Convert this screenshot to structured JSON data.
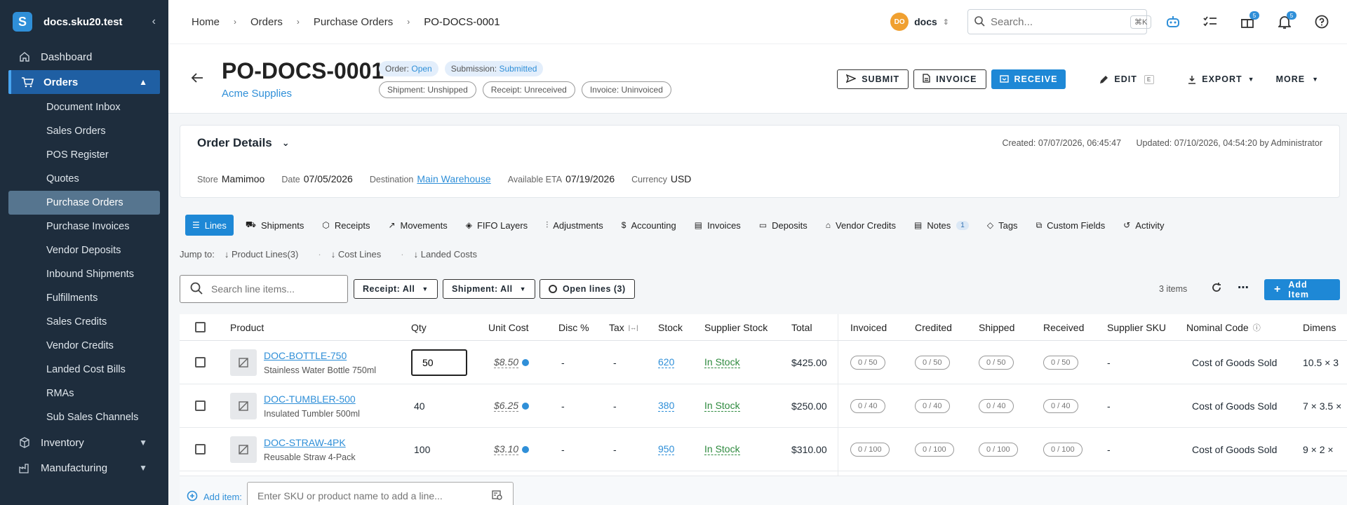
{
  "sidebar": {
    "logo": "S",
    "workspace": "docs.sku20.test",
    "items": [
      {
        "label": "Dashboard"
      },
      {
        "label": "Orders"
      },
      {
        "label": "Inventory"
      },
      {
        "label": "Manufacturing"
      }
    ],
    "orders_sub": [
      "Document Inbox",
      "Sales Orders",
      "POS Register",
      "Quotes",
      "Purchase Orders",
      "Purchase Invoices",
      "Vendor Deposits",
      "Inbound Shipments",
      "Fulfillments",
      "Sales Credits",
      "Vendor Credits",
      "Landed Cost Bills",
      "RMAs",
      "Sub Sales Channels"
    ]
  },
  "topbar": {
    "breadcrumbs": [
      "Home",
      "Orders",
      "Purchase Orders",
      "PO-DOCS-0001"
    ],
    "workspace_initials": "DO",
    "workspace_name": "docs",
    "search_placeholder": "Search...",
    "search_shortcut": "⌘K",
    "gift_badge": "5",
    "notif_badge": "5"
  },
  "header": {
    "title": "PO-DOCS-0001",
    "vendor": "Acme Supplies",
    "status_order_label": "Order:",
    "status_order_value": "Open",
    "status_submission_label": "Submission:",
    "status_submission_value": "Submitted",
    "shipment_status": "Shipment: Unshipped",
    "receipt_status": "Receipt: Unreceived",
    "invoice_status": "Invoice: Uninvoiced",
    "submit_label": "SUBMIT",
    "invoice_label": "INVOICE",
    "receive_label": "RECEIVE",
    "edit_label": "EDIT",
    "edit_shortcut": "E",
    "export_label": "EXPORT",
    "more_label": "MORE"
  },
  "details": {
    "title": "Order Details",
    "created": "Created: 07/07/2026, 06:45:47",
    "updated": "Updated: 07/10/2026, 04:54:20 by Administrator",
    "fields": [
      {
        "k": "Store",
        "v": "Mamimoo"
      },
      {
        "k": "Date",
        "v": "07/05/2026"
      },
      {
        "k": "Destination",
        "v": "Main Warehouse"
      },
      {
        "k": "Available ETA",
        "v": "07/19/2026"
      },
      {
        "k": "Currency",
        "v": "USD"
      }
    ]
  },
  "tabs": [
    "Lines",
    "Shipments",
    "Receipts",
    "Movements",
    "FIFO Layers",
    "Adjustments",
    "Accounting",
    "Invoices",
    "Deposits",
    "Vendor Credits",
    "Notes",
    "Tags",
    "Custom Fields",
    "Activity"
  ],
  "notes_count": "1",
  "jump": {
    "label": "Jump to:",
    "links": [
      "Product Lines(3)",
      "Cost Lines",
      "Landed Costs"
    ]
  },
  "toolbar": {
    "search_placeholder": "Search line items...",
    "receipt_filter": "Receipt: All",
    "shipment_filter": "Shipment: All",
    "open_lines": "Open lines (3)",
    "items_count": "3 items",
    "add_item": "Add Item"
  },
  "table": {
    "headers": [
      "Product",
      "Qty",
      "Unit Cost",
      "Disc %",
      "Tax",
      "Stock",
      "Supplier Stock",
      "Total",
      "Invoiced",
      "Credited",
      "Shipped",
      "Received",
      "Supplier SKU",
      "Nominal Code",
      "Dimens"
    ],
    "rows": [
      {
        "sku": "DOC-BOTTLE-750",
        "name": "Stainless Water Bottle 750ml",
        "qty": "50",
        "unit_cost": "$8.50",
        "disc": "-",
        "tax": "-",
        "stock": "620",
        "supplier_stock": "In Stock",
        "total": "$425.00",
        "invoiced": "0 / 50",
        "credited": "0 / 50",
        "shipped": "0 / 50",
        "received": "0 / 50",
        "supplier_sku": "-",
        "nominal": "Cost of Goods Sold",
        "dims": "10.5 × 3"
      },
      {
        "sku": "DOC-TUMBLER-500",
        "name": "Insulated Tumbler 500ml",
        "qty": "40",
        "unit_cost": "$6.25",
        "disc": "-",
        "tax": "-",
        "stock": "380",
        "supplier_stock": "In Stock",
        "total": "$250.00",
        "invoiced": "0 / 40",
        "credited": "0 / 40",
        "shipped": "0 / 40",
        "received": "0 / 40",
        "supplier_sku": "-",
        "nominal": "Cost of Goods Sold",
        "dims": "7 × 3.5 ×"
      },
      {
        "sku": "DOC-STRAW-4PK",
        "name": "Reusable Straw 4-Pack",
        "qty": "100",
        "unit_cost": "$3.10",
        "disc": "-",
        "tax": "-",
        "stock": "950",
        "supplier_stock": "In Stock",
        "total": "$310.00",
        "invoiced": "0 / 100",
        "credited": "0 / 100",
        "shipped": "0 / 100",
        "received": "0 / 100",
        "supplier_sku": "-",
        "nominal": "Cost of Goods Sold",
        "dims": "9 × 2 ×"
      }
    ]
  },
  "addbar": {
    "label": "Add item:",
    "placeholder": "Enter SKU or product name to add a line..."
  }
}
